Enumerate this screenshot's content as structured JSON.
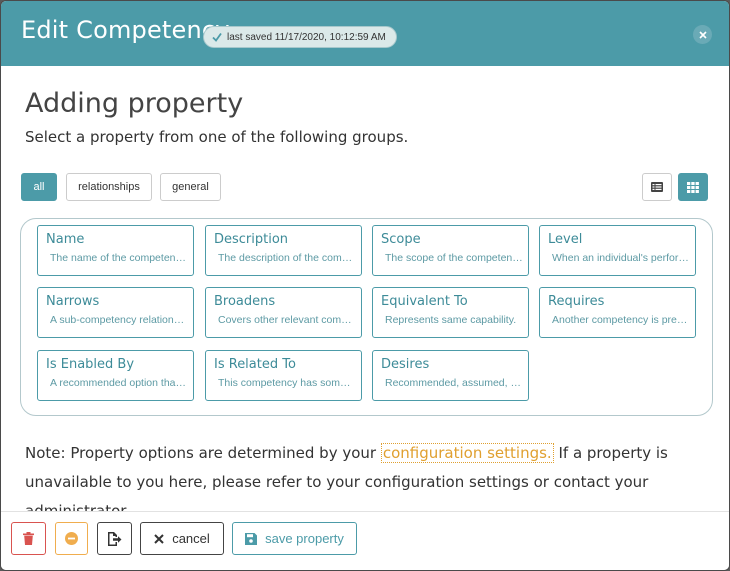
{
  "header": {
    "title": "Edit Competency",
    "saved_badge": "last saved 11/17/2020, 10:12:59 AM"
  },
  "main": {
    "title": "Adding property",
    "subtitle": "Select a property from one of the following groups."
  },
  "filters": [
    {
      "label": "all",
      "active": true
    },
    {
      "label": "relationships",
      "active": false
    },
    {
      "label": "general",
      "active": false
    }
  ],
  "properties": [
    {
      "name": "Name",
      "description": "The name of the competency."
    },
    {
      "name": "Description",
      "description": "The description of the competency."
    },
    {
      "name": "Scope",
      "description": "The scope of the competency."
    },
    {
      "name": "Level",
      "description": "When an individual's performance."
    },
    {
      "name": "Narrows",
      "description": "A sub-competency relationship."
    },
    {
      "name": "Broadens",
      "description": "Covers other relevant competencies."
    },
    {
      "name": "Equivalent To",
      "description": "Represents same capability."
    },
    {
      "name": "Requires",
      "description": "Another competency is prerequisite."
    },
    {
      "name": "Is Enabled By",
      "description": "A recommended option that enables."
    },
    {
      "name": "Is Related To",
      "description": "This competency has some relation."
    },
    {
      "name": "Desires",
      "description": "Recommended, assumed, or desired."
    }
  ],
  "note": {
    "before": "Note: Property options are determined by your ",
    "link": "configuration settings.",
    "after": " If a property is unavailable to you here, please refer to your configuration settings or contact your administrator."
  },
  "footer": {
    "cancel_label": "cancel",
    "save_label": "save property"
  },
  "colors": {
    "accent": "#4c9ba8",
    "danger": "#d9534f",
    "warning": "#f0ad4e",
    "link": "#e0a030"
  },
  "icons": {
    "close": "close-icon",
    "check": "check-icon",
    "list_view": "list-view-icon",
    "grid_view": "grid-view-icon",
    "delete": "trash-icon",
    "remove": "minus-circle-icon",
    "export": "export-icon",
    "cancel": "x-icon",
    "save": "save-icon"
  }
}
